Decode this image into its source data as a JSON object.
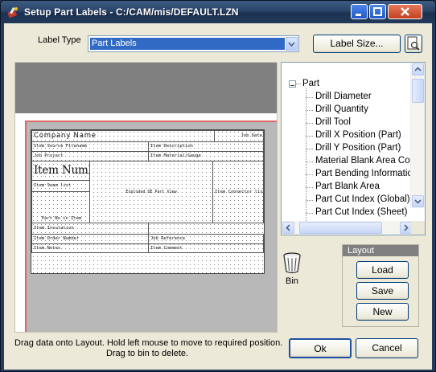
{
  "window": {
    "title": "Setup Part Labels - C:/CAM/mis/DEFAULT.LZN"
  },
  "form": {
    "label_type_label": "Label Type",
    "label_type_value": "Part Labels",
    "label_size_button": "Label Size...",
    "print_preview_icon": "print-preview-icon"
  },
  "label": {
    "company_name": "Company Name",
    "job_date": "Job Date",
    "item_source_filename": "Item Source Filename",
    "item_description": "Item Description",
    "job_project": "Job Project",
    "item_material_gauge": "Item Material/Gauge",
    "item_number": "Item Number",
    "item_seam_list": "Item Seam list",
    "exploded_part_view": "Exploded DE Part View",
    "item_connector_list": "Item Connector list",
    "part_no_in_item": "Part No in Item",
    "item_insulation": "Item Insulation",
    "item_order_number": "Item Order Number",
    "job_reference": "Job Reference",
    "item_notes": "Item Notes",
    "item_comment": "Item Comment"
  },
  "tree": {
    "root": "Part",
    "items": [
      "Drill Diameter",
      "Drill Quantity",
      "Drill Tool",
      "Drill X Position (Part)",
      "Drill Y Position (Part)",
      "Material Blank Area Cost",
      "Part Bending Information",
      "Part Blank Area",
      "Part Cut Index (Global)",
      "Part Cut Index (Sheet)"
    ]
  },
  "bin": {
    "label": "Bin"
  },
  "layout": {
    "heading": "Layout",
    "load": "Load",
    "save": "Save",
    "new": "New"
  },
  "footer": {
    "hint_line1": "Drag data onto Layout. Hold left mouse to move to required position.",
    "hint_line2": "Drag to bin to delete.",
    "ok": "Ok",
    "cancel": "Cancel"
  },
  "colors": {
    "titlebar": "#2a4468",
    "selection": "#316ac5",
    "red_margin": "#e0666a",
    "preview_gray": "#808080"
  }
}
